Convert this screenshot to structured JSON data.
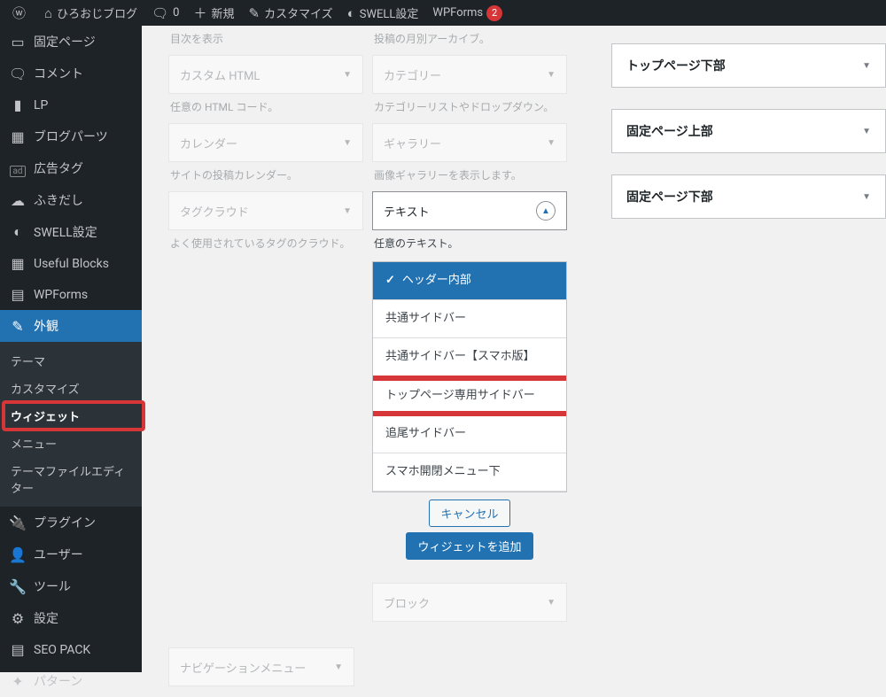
{
  "adminbar": {
    "site_name": "ひろおじブログ",
    "comments": "0",
    "new": "新規",
    "customize": "カスタマイズ",
    "swell": "SWELL設定",
    "wpforms": "WPForms",
    "wpforms_badge": "2"
  },
  "sidebar": {
    "pages": "固定ページ",
    "comments": "コメント",
    "lp": "LP",
    "blog_parts": "ブログパーツ",
    "ad_tag": "広告タグ",
    "fukidashi": "ふきだし",
    "swell": "SWELL設定",
    "useful_blocks": "Useful Blocks",
    "wpforms": "WPForms",
    "appearance": "外観",
    "sub_theme": "テーマ",
    "sub_customize": "カスタマイズ",
    "sub_widgets": "ウィジェット",
    "sub_menu": "メニュー",
    "sub_editor": "テーマファイルエディター",
    "plugins": "プラグイン",
    "users": "ユーザー",
    "tools": "ツール",
    "settings": "設定",
    "seopack": "SEO PACK",
    "pattern": "パターン"
  },
  "widgets_left": [
    {
      "label": "カスタム HTML",
      "desc": "任意の HTML コード。",
      "header_desc": "目次を表示"
    },
    {
      "label": "カレンダー",
      "desc": "サイトの投稿カレンダー。"
    },
    {
      "label": "タグクラウド",
      "desc": "よく使用されているタグのクラウド。"
    },
    {
      "label": "ナビゲーションメニュー"
    }
  ],
  "widgets_right": [
    {
      "label": "カテゴリー",
      "desc": "カテゴリーリストやドロップダウン。",
      "header_desc": "投稿の月別アーカイブ。"
    },
    {
      "label": "ギャラリー",
      "desc": "画像ギャラリーを表示します。"
    },
    {
      "active_label": "テキスト",
      "active_desc": "任意のテキスト。"
    },
    {
      "label": "ブロック"
    }
  ],
  "dropdown": {
    "items": [
      "ヘッダー内部",
      "共通サイドバー",
      "共通サイドバー【スマホ版】",
      "トップページ専用サイドバー",
      "追尾サイドバー",
      "スマホ開閉メニュー下"
    ],
    "cancel": "キャンセル",
    "add": "ウィジェットを追加"
  },
  "areas": [
    "トップページ下部",
    "固定ページ上部",
    "固定ページ下部"
  ]
}
